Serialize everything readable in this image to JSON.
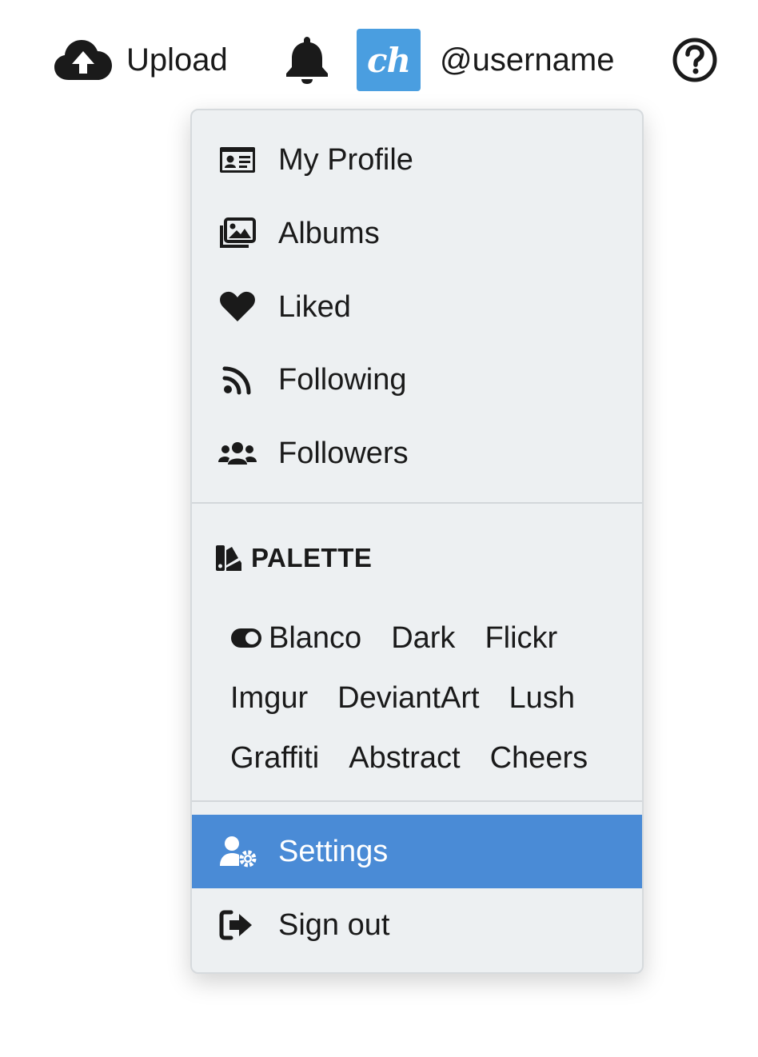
{
  "topbar": {
    "upload_label": "Upload",
    "upload_icon": "cloud-upload-icon",
    "notifications_icon": "bell-icon",
    "avatar_text": "ch",
    "avatar_color": "#4a9ee0",
    "username": "@username",
    "help_icon": "question-circle-icon"
  },
  "menu": {
    "items": [
      {
        "label": "My Profile",
        "icon": "id-card-icon"
      },
      {
        "label": "Albums",
        "icon": "images-icon"
      },
      {
        "label": "Liked",
        "icon": "heart-icon"
      },
      {
        "label": "Following",
        "icon": "rss-icon"
      },
      {
        "label": "Followers",
        "icon": "users-icon"
      }
    ],
    "palette": {
      "heading": "PALETTE",
      "icon": "swatchbook-icon",
      "options": [
        "Blanco",
        "Dark",
        "Flickr",
        "Imgur",
        "DeviantArt",
        "Lush",
        "Graffiti",
        "Abstract",
        "Cheers"
      ],
      "selected": "Blanco",
      "selected_icon": "toggle-on-icon"
    },
    "settings": {
      "label": "Settings",
      "icon": "user-cog-icon",
      "active": true
    },
    "signout": {
      "label": "Sign out",
      "icon": "sign-out-icon"
    },
    "active_color": "#4a8bd6",
    "background_color": "#edf0f2"
  }
}
